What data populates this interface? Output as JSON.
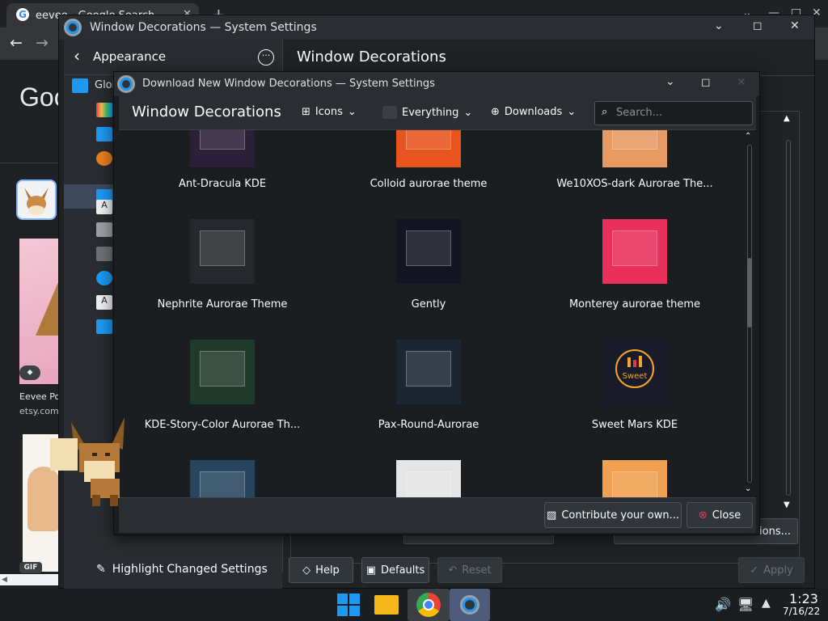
{
  "browser": {
    "tab_title": "eevee - Google Search",
    "close_tab": "✕",
    "new_tab": "+",
    "logo_partial": "Goo",
    "result_caption": "Eevee Po",
    "result_site": "etsy.com",
    "gif_badge": "GIF",
    "tag_icon": "tag-icon"
  },
  "settings": {
    "window_title": "Window Decorations — System Settings",
    "back_label": "Appearance",
    "page_title": "Window Decorations",
    "sidebar_partial": "Glob",
    "highlight_changed": "Highlight Changed Settings",
    "help": "Help",
    "defaults": "Defaults",
    "reset": "Reset",
    "apply": "Apply",
    "behind_button_partial": "ations..."
  },
  "dialog": {
    "window_title": "Download New Window Decorations — System Settings",
    "heading": "Window Decorations",
    "view_mode": "Icons",
    "filter": "Everything",
    "sort": "Downloads",
    "search_placeholder": "Search...",
    "contribute": "Contribute your own...",
    "close": "Close",
    "items": [
      {
        "label": "Ant-Dracula KDE",
        "color": "#2b1f3a"
      },
      {
        "label": "Colloid aurorae theme",
        "color": "#e8541e"
      },
      {
        "label": "We10XOS-dark Aurorae The...",
        "color": "#e89a63"
      },
      {
        "label": "Nephrite Aurorae Theme",
        "color": "#25292d"
      },
      {
        "label": "Gently",
        "color": "#131622"
      },
      {
        "label": "Monterey aurorae theme",
        "color": "#e8305a"
      },
      {
        "label": "KDE-Story-Color Aurorae Th...",
        "color": "#1f3a2a"
      },
      {
        "label": "Pax-Round-Aurorae",
        "color": "#1d2633"
      },
      {
        "label": "Sweet Mars KDE",
        "color": "#1a1b2a"
      },
      {
        "label": "",
        "color": "#27455e"
      },
      {
        "label": "",
        "color": "#e5e5e5"
      },
      {
        "label": "",
        "color": "#f0a050"
      }
    ],
    "sweet_logo_text": "Sweet"
  },
  "taskbar": {
    "time": "1:23",
    "date": "7/16/22"
  },
  "colors": {
    "accent": "#1d99f3",
    "close_red": "#da4453"
  }
}
